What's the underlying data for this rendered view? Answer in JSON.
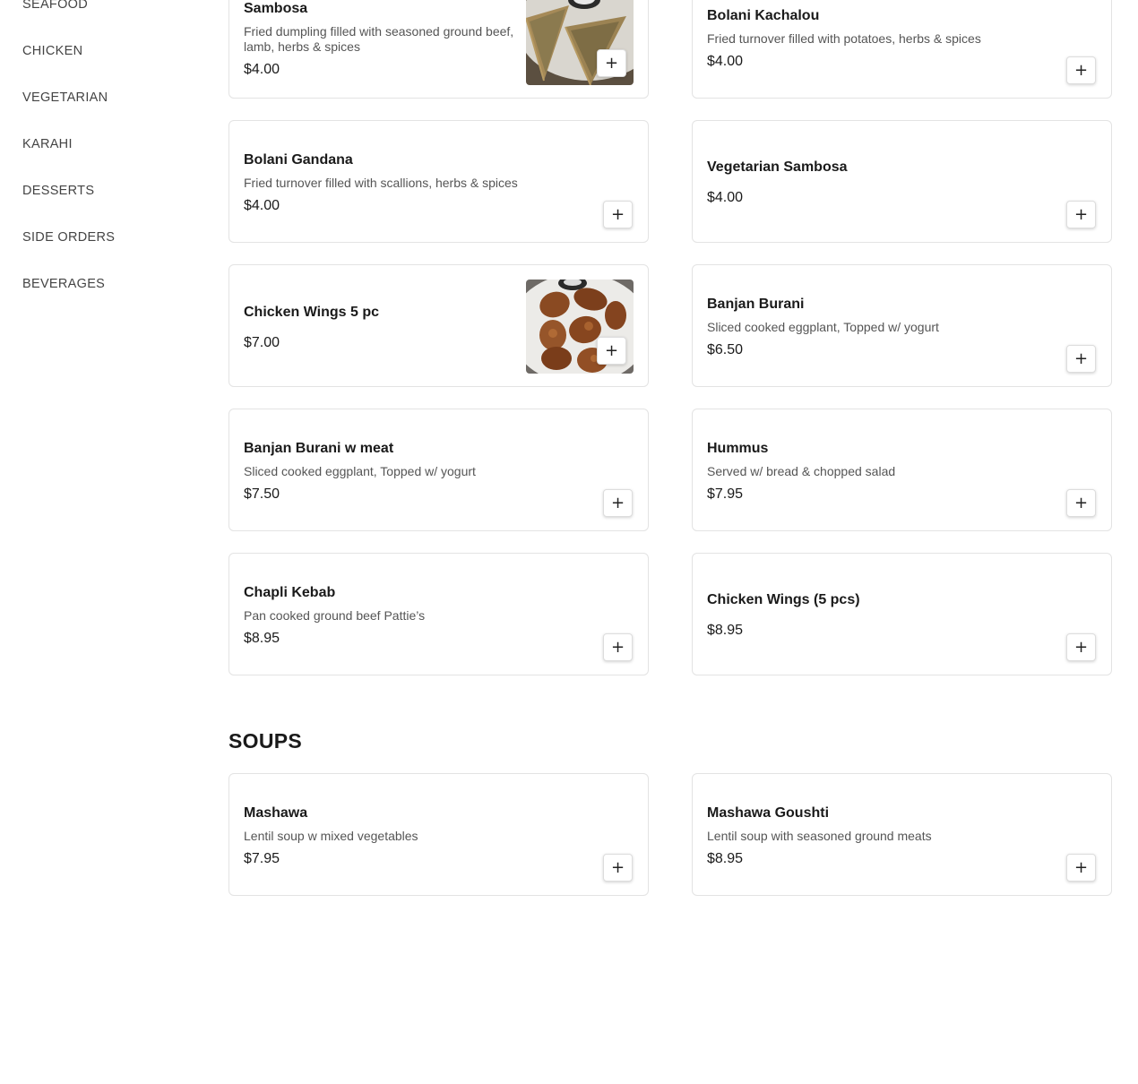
{
  "sidebar": {
    "categories": [
      "SEAFOOD",
      "CHICKEN",
      "VEGETARIAN",
      "KARAHI",
      "DESSERTS",
      "SIDE ORDERS",
      "BEVERAGES"
    ]
  },
  "appetizers": [
    {
      "name": "Sambosa",
      "description": "Fried dumpling filled with seasoned ground beef, lamb, herbs & spices",
      "price": "$4.00",
      "image": "sambosa-photo"
    },
    {
      "name": "Bolani Kachalou",
      "description": "Fried turnover filled with potatoes, herbs & spices",
      "price": "$4.00"
    },
    {
      "name": "Bolani Gandana",
      "description": "Fried turnover filled with scallions, herbs & spices",
      "price": "$4.00"
    },
    {
      "name": "Vegetarian Sambosa",
      "description": "",
      "price": "$4.00"
    },
    {
      "name": "Chicken Wings 5 pc",
      "description": "",
      "price": "$7.00",
      "image": "chicken-wings-photo"
    },
    {
      "name": "Banjan Burani",
      "description": "Sliced cooked eggplant, Topped w/ yogurt",
      "price": "$6.50"
    },
    {
      "name": "Banjan Burani w meat",
      "description": "Sliced cooked eggplant, Topped w/ yogurt",
      "price": "$7.50"
    },
    {
      "name": "Hummus",
      "description": "Served w/ bread & chopped salad",
      "price": "$7.95"
    },
    {
      "name": "Chapli Kebab",
      "description": "Pan cooked ground beef Pattie’s",
      "price": "$8.95"
    },
    {
      "name": "Chicken Wings (5 pcs)",
      "description": "",
      "price": "$8.95"
    }
  ],
  "soups": {
    "title": "SOUPS",
    "items": [
      {
        "name": "Mashawa",
        "description": "Lentil soup w mixed vegetables",
        "price": "$7.95"
      },
      {
        "name": "Mashawa Goushti",
        "description": "Lentil soup with seasoned ground meats",
        "price": "$8.95"
      }
    ]
  },
  "add_button": {
    "label": "+",
    "icon": "plus-icon"
  }
}
